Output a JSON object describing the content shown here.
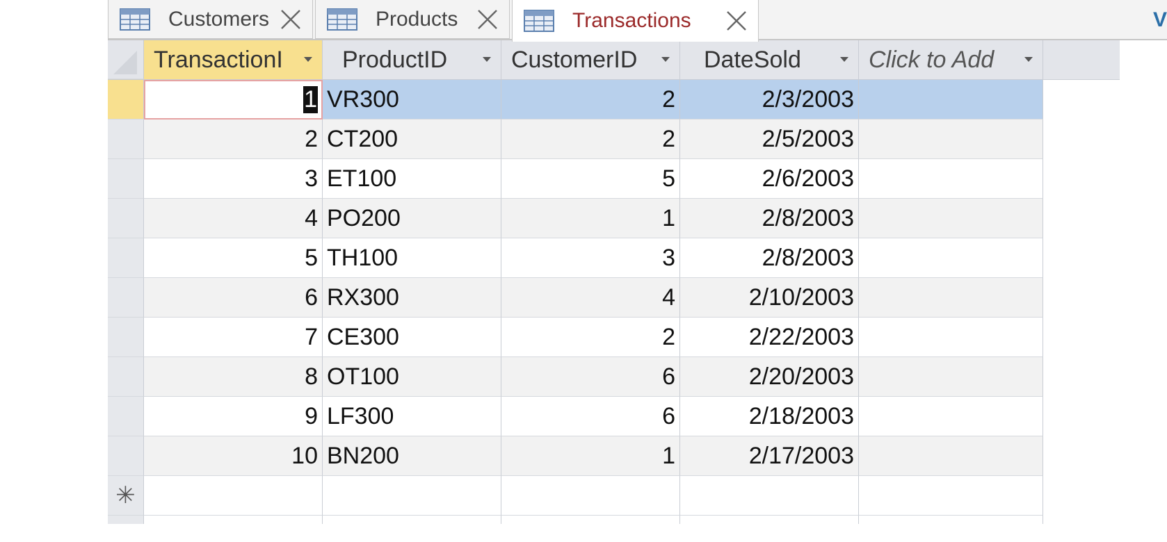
{
  "tabs": [
    {
      "label": "Customers",
      "icon": "table-icon",
      "active": false
    },
    {
      "label": "Products",
      "icon": "table-icon",
      "active": false
    },
    {
      "label": "Transactions",
      "icon": "table-icon",
      "active": true
    }
  ],
  "edge_text": "V",
  "colors": {
    "active_tab_text": "#9b2a2a",
    "selected_row": "#b8d0ec",
    "selected_header": "#f8e08f",
    "header_bg": "#e3e5ea"
  },
  "table": {
    "columns": [
      {
        "label": "TransactionI",
        "sortable": true,
        "selected": true
      },
      {
        "label": "ProductID",
        "sortable": true
      },
      {
        "label": "CustomerID",
        "sortable": true
      },
      {
        "label": "DateSold",
        "sortable": true
      },
      {
        "label": "Click to Add",
        "sortable": true
      }
    ],
    "rows": [
      {
        "transaction_id": "1",
        "product_id": "VR300",
        "customer_id": "2",
        "date_sold": "2/3/2003",
        "extra": ""
      },
      {
        "transaction_id": "2",
        "product_id": "CT200",
        "customer_id": "2",
        "date_sold": "2/5/2003",
        "extra": ""
      },
      {
        "transaction_id": "3",
        "product_id": "ET100",
        "customer_id": "5",
        "date_sold": "2/6/2003",
        "extra": ""
      },
      {
        "transaction_id": "4",
        "product_id": "PO200",
        "customer_id": "1",
        "date_sold": "2/8/2003",
        "extra": ""
      },
      {
        "transaction_id": "5",
        "product_id": "TH100",
        "customer_id": "3",
        "date_sold": "2/8/2003",
        "extra": ""
      },
      {
        "transaction_id": "6",
        "product_id": "RX300",
        "customer_id": "4",
        "date_sold": "2/10/2003",
        "extra": ""
      },
      {
        "transaction_id": "7",
        "product_id": "CE300",
        "customer_id": "2",
        "date_sold": "2/22/2003",
        "extra": ""
      },
      {
        "transaction_id": "8",
        "product_id": "OT100",
        "customer_id": "6",
        "date_sold": "2/20/2003",
        "extra": ""
      },
      {
        "transaction_id": "9",
        "product_id": "LF300",
        "customer_id": "6",
        "date_sold": "2/18/2003",
        "extra": ""
      },
      {
        "transaction_id": "10",
        "product_id": "BN200",
        "customer_id": "1",
        "date_sold": "2/17/2003",
        "extra": ""
      }
    ],
    "new_record_symbol": "✳"
  }
}
